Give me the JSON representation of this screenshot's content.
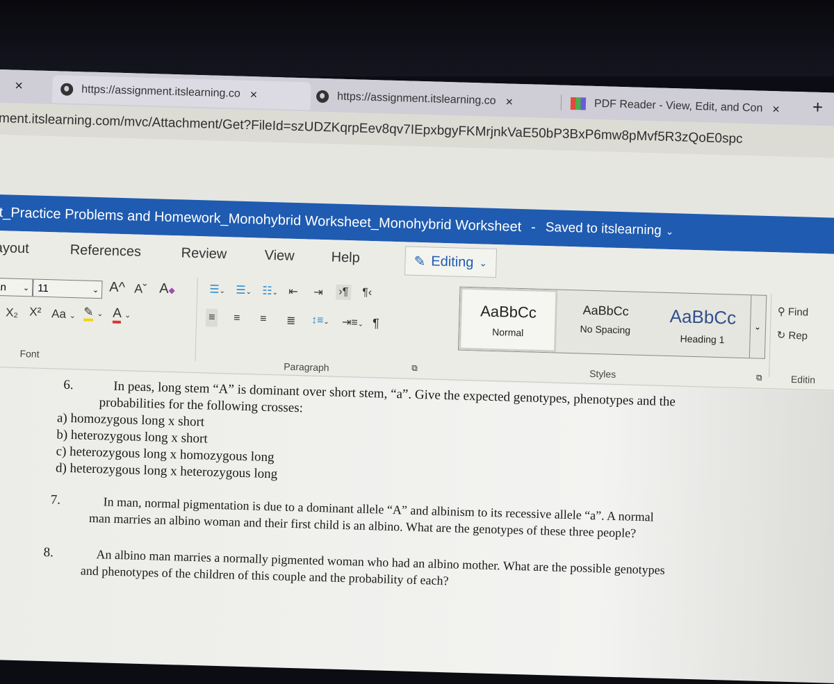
{
  "browser": {
    "tabs": [
      {
        "title": "https://assignment.itslearning.co",
        "icon": "globe-icon",
        "active": true
      },
      {
        "title": "https://assignment.itslearning.co",
        "icon": "globe-icon",
        "active": false
      },
      {
        "title": "PDF Reader - View, Edit, and Con",
        "icon": "pdf-reader-icon",
        "active": false
      }
    ],
    "close_glyph": "×",
    "new_tab_glyph": "+",
    "url": "ment.itslearning.com/mvc/Attachment/Get?FileId=szUDZKqrpEev8qv7IEpxbgyFKMrjnkVaE50bP3BxP6mw8pMvf5R3zQoE0spc"
  },
  "app": {
    "doc_title": "it_Practice Problems and Homework_Monohybrid Worksheet_Monohybrid Worksheet",
    "title_sep": "-",
    "save_status": "Saved to itslearning",
    "menu": [
      "ayout",
      "References",
      "Review",
      "View",
      "Help"
    ],
    "editing_label": "Editing"
  },
  "ribbon": {
    "font_name": "an",
    "font_size": "11",
    "font_buttons": [
      "A^",
      "Aˇ",
      "A"
    ],
    "format_buttons": [
      "X₂",
      "X²",
      "Aa"
    ],
    "group_labels": {
      "font": "Font",
      "paragraph": "Paragraph",
      "styles": "Styles",
      "editing": "Editin"
    },
    "styles": [
      {
        "sample": "AaBbCc",
        "name": "Normal"
      },
      {
        "sample": "AaBbCc",
        "name": "No Spacing"
      },
      {
        "sample": "AaBbCc",
        "name": "Heading 1"
      }
    ],
    "find_label": "Find",
    "replace_label": "Rep",
    "colors": {
      "highlight": "#f2d60d",
      "font_color": "#d93636",
      "brand": "#1f5bb0"
    }
  },
  "document": {
    "questions": [
      {
        "number": "6.",
        "lines": [
          "In peas, long stem “A” is dominant over short stem, “a”.  Give the expected genotypes, phenotypes and the",
          "probabilities for the following crosses:"
        ],
        "items": [
          "a) homozygous long x short",
          "b) heterozygous long x short",
          "c) heterozygous long x homozygous long",
          "d) heterozygous long x heterozygous long"
        ]
      },
      {
        "number": "7.",
        "lines": [
          "In man, normal pigmentation is due to a dominant allele “A” and albinism to its recessive allele “a”.  A normal",
          "man marries an albino woman and their first child is an albino.  What are the genotypes of these three people?"
        ]
      },
      {
        "number": "8.",
        "lines": [
          "An albino man marries a normally pigmented woman who had an albino mother.  What are the possible genotypes",
          "and phenotypes of the children of this couple and the probability of each?"
        ]
      }
    ]
  }
}
